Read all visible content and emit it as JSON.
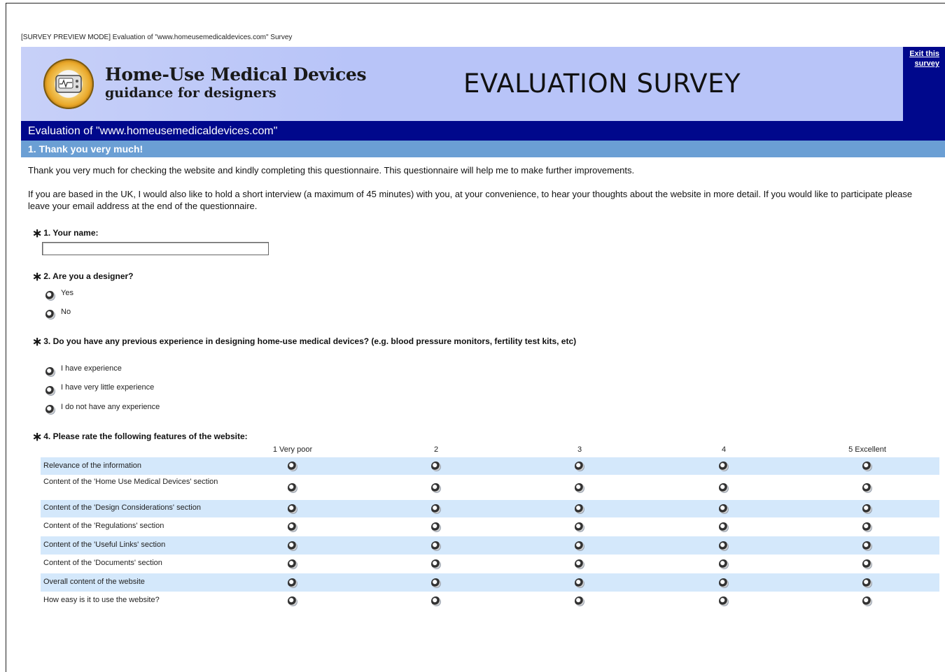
{
  "preview_line": "[SURVEY PREVIEW MODE] Evaluation of \"www.homeusemedicaldevices.com\" Survey",
  "header": {
    "logo_title": "Home-Use Medical Devices",
    "logo_subtitle": "guidance for designers",
    "survey_heading": "EVALUATION SURVEY",
    "exit_link": "Exit this survey"
  },
  "survey_bar": "Evaluation of \"www.homeusemedicaldevices.com\"",
  "page_bar": "1. Thank you very much!",
  "intro": {
    "p1": "Thank you very much for checking the website and kindly completing this questionnaire. This questionnaire will help me to make further improvements.",
    "p2": "If you are based in the UK, I would also like to hold a short interview (a maximum of 45 minutes) with you, at your convenience, to hear your thoughts about the website in more detail. If you would like to participate please leave your email address at the end of the questionnaire."
  },
  "q1": {
    "star": "∗",
    "title": "1. Your name:",
    "value": ""
  },
  "q2": {
    "star": "∗",
    "title": "2. Are you a designer?",
    "options": [
      "Yes",
      "No"
    ]
  },
  "q3": {
    "star": "∗",
    "title": "3. Do you have any previous experience in designing home-use medical devices? (e.g. blood pressure monitors, fertility test kits, etc)",
    "options": [
      "I have experience",
      "I have very little experience",
      "I do not have any experience"
    ]
  },
  "q4": {
    "star": "∗",
    "title": "4. Please rate the following features of the website:",
    "columns": [
      "1 Very poor",
      "2",
      "3",
      "4",
      "5 Excellent"
    ],
    "rows": [
      "Relevance of the information",
      "Content of the 'Home Use Medical Devices' section",
      "Content of the 'Design Considerations' section",
      "Content of the 'Regulations' section",
      "Content of the 'Useful Links' section",
      "Content of the 'Documents' section",
      "Overall content of the website",
      "How easy is it to use the website?"
    ]
  }
}
